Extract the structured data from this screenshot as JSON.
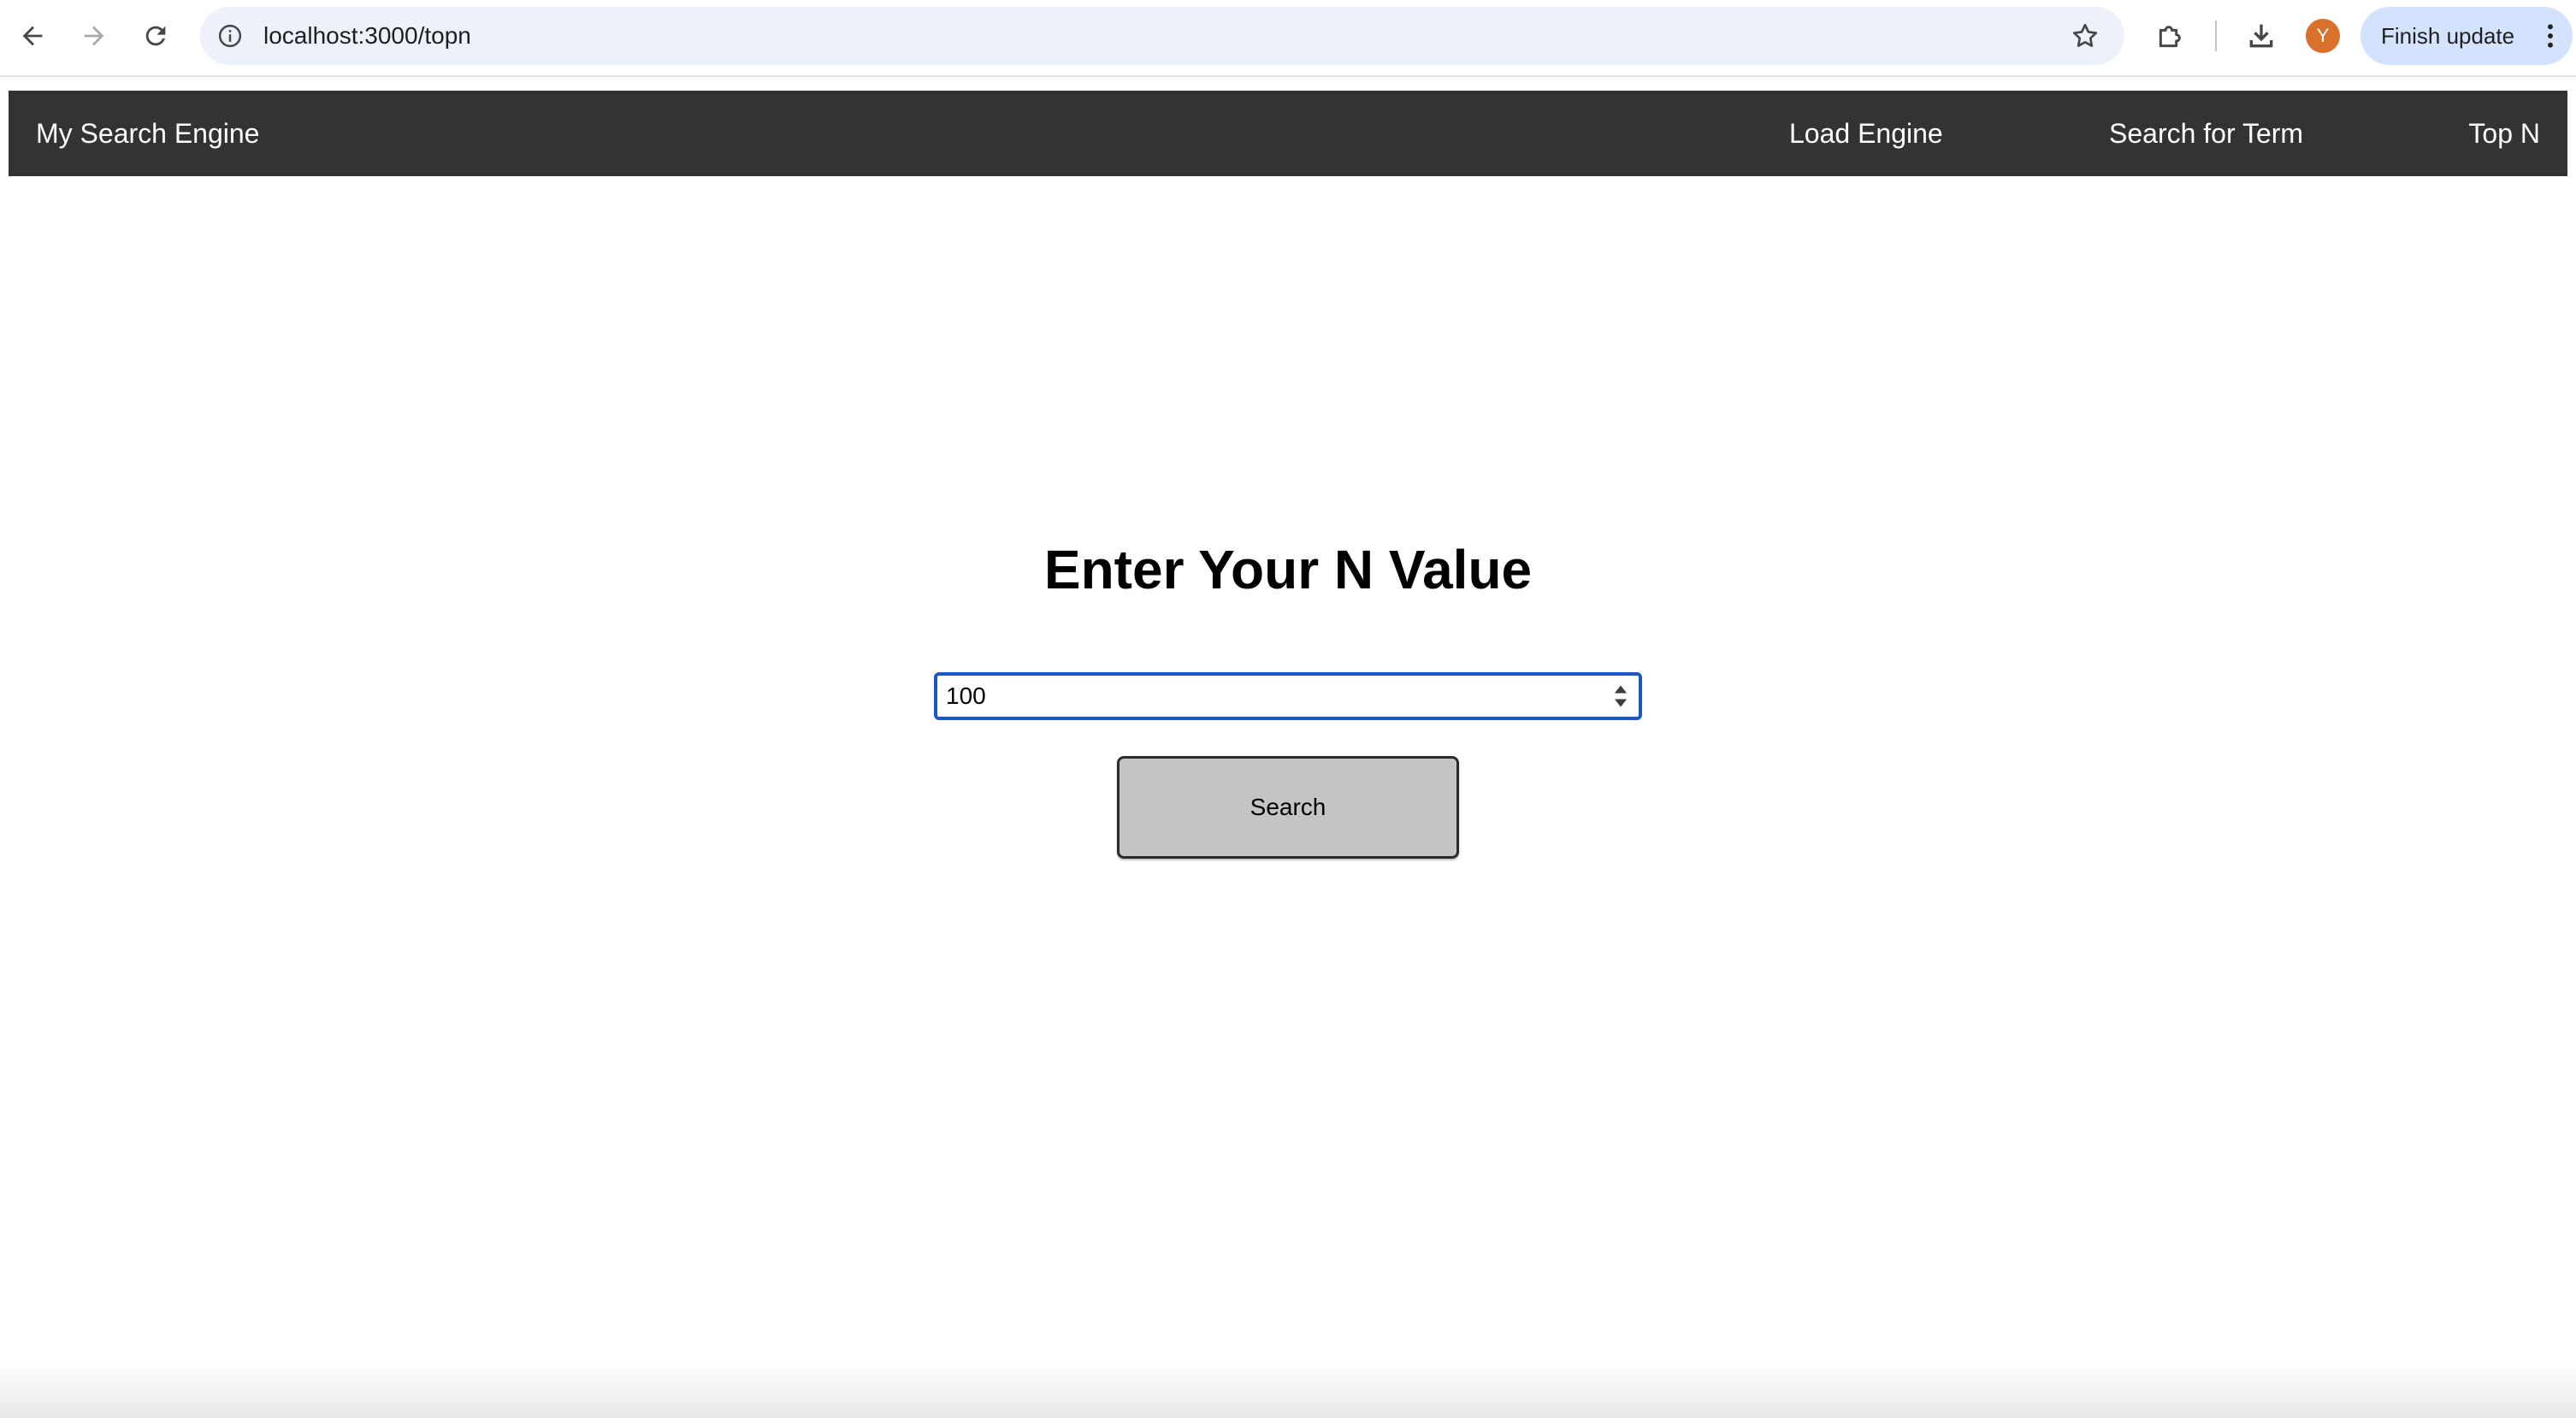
{
  "browser": {
    "url": "localhost:3000/topn",
    "profile_initial": "Y",
    "finish_update_label": "Finish update",
    "icons": {
      "back": "arrow-left-icon",
      "forward": "arrow-right-icon",
      "reload": "reload-icon",
      "site_info": "info-icon",
      "bookmark": "star-icon",
      "extensions": "puzzle-icon",
      "downloads": "download-icon",
      "menu": "kebab-menu-icon"
    },
    "colors": {
      "omnibox_bg": "#edf1f9",
      "avatar_bg": "#d9702b",
      "update_chip_bg": "#d3e3fd"
    }
  },
  "navbar": {
    "brand": "My Search Engine",
    "links": [
      {
        "label": "Load Engine"
      },
      {
        "label": "Search for Term"
      },
      {
        "label": "Top N"
      }
    ],
    "background": "#333333"
  },
  "main": {
    "heading": "Enter Your N Value",
    "n_input": {
      "value": "100",
      "type": "number"
    },
    "search_button_label": "Search"
  }
}
